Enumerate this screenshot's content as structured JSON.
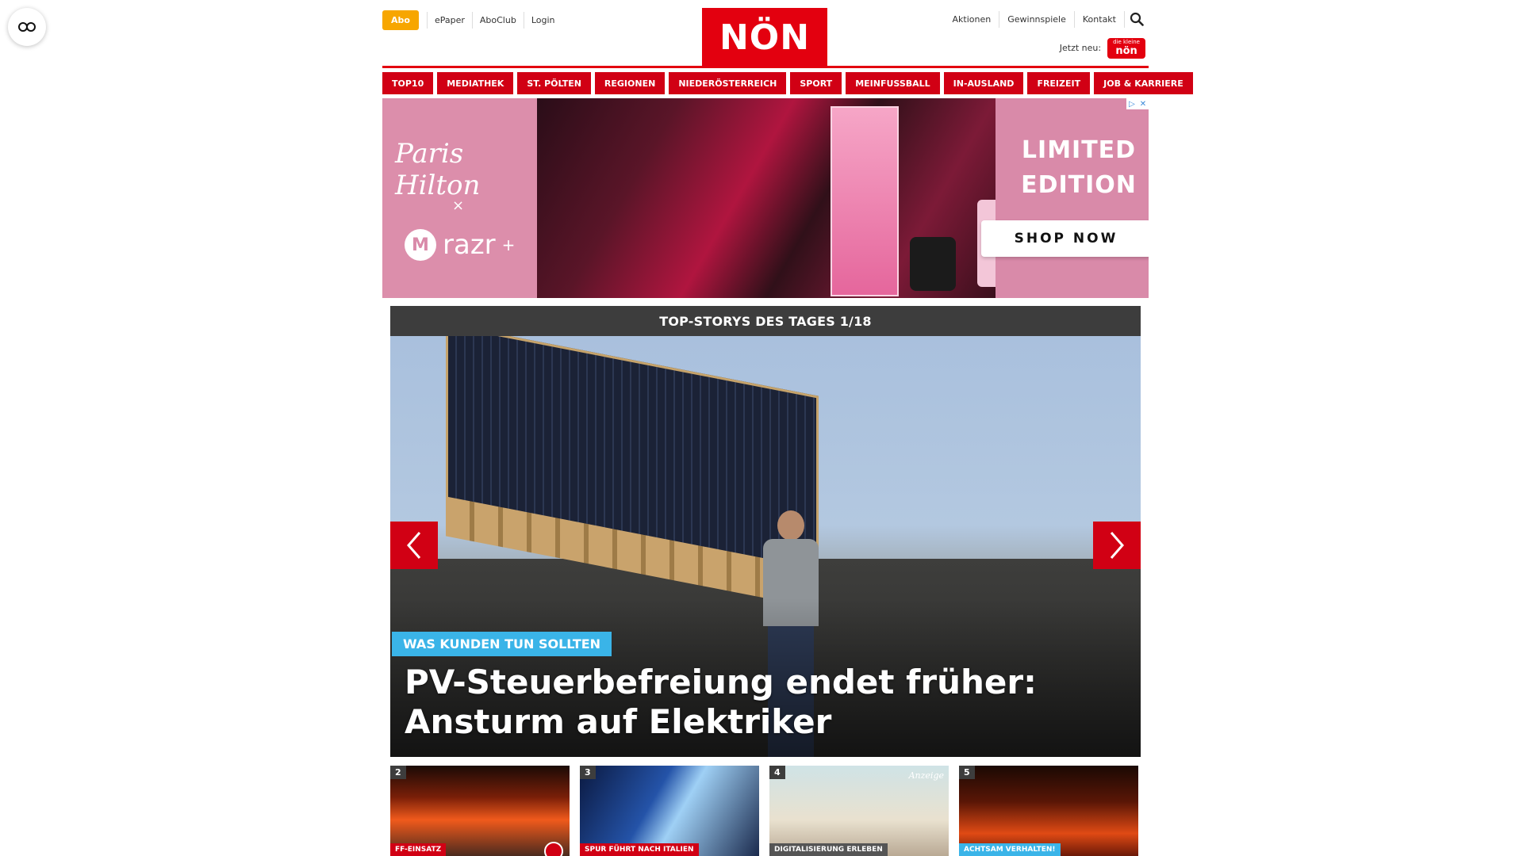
{
  "header": {
    "abo_label": "Abo",
    "left_links": [
      "ePaper",
      "AboClub",
      "Login"
    ],
    "logo_text": "NÖN",
    "right_links": [
      "Aktionen",
      "Gewinnspiele",
      "Kontakt"
    ],
    "jetzt_neu_label": "Jetzt neu:",
    "badge_small": "die kleine",
    "badge_text": "nön"
  },
  "main_nav": [
    "TOP10",
    "MEDIATHEK",
    "ST. PÖLTEN",
    "REGIONEN",
    "NIEDERÖSTERREICH",
    "SPORT",
    "MEINFUSSBALL",
    "IN-AUSLAND",
    "FREIZEIT",
    "JOB & KARRIERE"
  ],
  "ad": {
    "brand_script": "Paris Hilton",
    "cross": "×",
    "partner": "razr",
    "partner_sup": "+",
    "headline_line1": "LIMITED",
    "headline_line2": "EDITION",
    "cta": "SHOP NOW"
  },
  "top_stories": {
    "heading": "TOP-STORYS DES TAGES 1/18",
    "kicker": "WAS KUNDEN TUN SOLLTEN",
    "headline": "PV-Steuerbefreiung endet früher: Ansturm auf Elektriker"
  },
  "teasers": [
    {
      "num": "2",
      "tag": "FF-EINSATZ"
    },
    {
      "num": "3",
      "tag": "SPUR FÜHRT NACH ITALIEN"
    },
    {
      "num": "4",
      "tag": "DIGITALISIERUNG ERLEBEN",
      "overlay": "Anzeige"
    },
    {
      "num": "5",
      "tag": "ACHTSAM VERHALTEN!"
    }
  ],
  "colors": {
    "brand_red": "#e3000f",
    "nav_red": "#d10014",
    "abo_orange": "#f7a600",
    "kicker_blue": "#3ab4e8",
    "stories_header": "#3d3d3d"
  },
  "icons": [
    "reader-mode-icon",
    "search-icon",
    "chevron-left-icon",
    "chevron-right-icon",
    "adchoices-icon",
    "close-icon",
    "camera-icon"
  ]
}
